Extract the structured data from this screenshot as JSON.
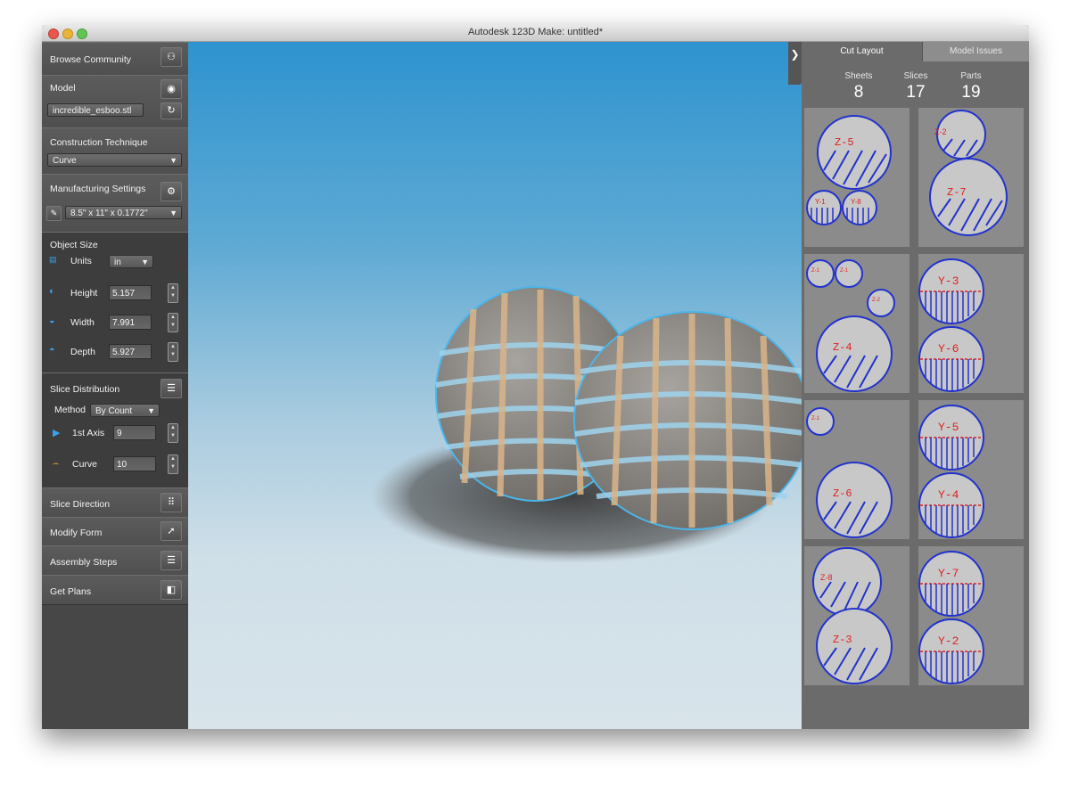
{
  "window": {
    "title": "Autodesk 123D Make: untitled*"
  },
  "left_panel": {
    "browse_community": "Browse Community",
    "model": {
      "label": "Model",
      "filename": "incredible_esboo.stl"
    },
    "construction_technique": {
      "label": "Construction Technique",
      "selected": "Curve"
    },
    "manufacturing_settings": {
      "label": "Manufacturing Settings",
      "selected": "8.5\" x 11\" x 0.1772\""
    },
    "object_size": {
      "label": "Object Size",
      "units_label": "Units",
      "units_value": "in",
      "height_label": "Height",
      "height_value": "5.157",
      "width_label": "Width",
      "width_value": "7.991",
      "depth_label": "Depth",
      "depth_value": "5.927"
    },
    "slice_distribution": {
      "label": "Slice Distribution",
      "method_label": "Method",
      "method_value": "By Count",
      "axis1_label": "1st Axis",
      "axis1_value": "9",
      "curve_label": "Curve",
      "curve_value": "10"
    },
    "slice_direction": "Slice Direction",
    "modify_form": "Modify Form",
    "assembly_steps": "Assembly Steps",
    "get_plans": "Get Plans"
  },
  "right_panel": {
    "tabs": [
      "Cut Layout",
      "Model Issues"
    ],
    "stats": [
      {
        "label": "Sheets",
        "value": "8"
      },
      {
        "label": "Slices",
        "value": "17"
      },
      {
        "label": "Parts",
        "value": "19"
      }
    ],
    "sheets": [
      {
        "parts": [
          "Z-5",
          "Y-1",
          "Y-8"
        ]
      },
      {
        "parts": [
          "Z-2",
          "Z-7"
        ]
      },
      {
        "parts": [
          "Z-1",
          "Z-1",
          "Z-2",
          "Z-4"
        ]
      },
      {
        "parts": [
          "Y-3",
          "Y-6"
        ]
      },
      {
        "parts": [
          "Z-1",
          "Z-6"
        ]
      },
      {
        "parts": [
          "Y-5",
          "Y-4"
        ]
      },
      {
        "parts": [
          "Z-8",
          "Z-3"
        ]
      },
      {
        "parts": [
          "Y-7",
          "Y-2"
        ]
      }
    ]
  },
  "colors": {
    "accent": "#3aa0e8",
    "viewport_top": "#2e93cf",
    "part_outline": "#2233cc",
    "part_label": "#e02020"
  }
}
